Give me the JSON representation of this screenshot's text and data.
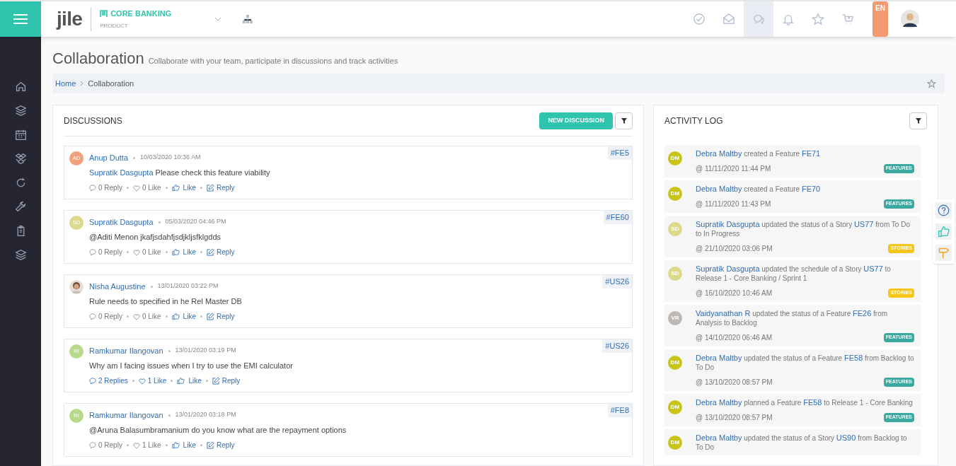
{
  "header": {
    "logo": "jile",
    "product_name": "CORE BANKING",
    "product_label": "PRODUCT",
    "language": "EN",
    "top_icons": [
      {
        "kind": "check",
        "selected": false
      },
      {
        "kind": "mail",
        "selected": false
      },
      {
        "kind": "chat",
        "selected": true
      },
      {
        "kind": "bell",
        "selected": false
      },
      {
        "kind": "star",
        "selected": false
      },
      {
        "kind": "cart",
        "selected": false
      }
    ]
  },
  "sidebar": {
    "items": [
      {
        "kind": "home"
      },
      {
        "kind": "layers"
      },
      {
        "kind": "calendar"
      },
      {
        "kind": "box"
      },
      {
        "kind": "cycle"
      },
      {
        "kind": "wrench"
      },
      {
        "kind": "clipboard"
      },
      {
        "kind": "layers"
      }
    ]
  },
  "page": {
    "title": "Collaboration",
    "subtitle": "Collaborate with your team, participate in discussions and track activities"
  },
  "breadcrumb": [
    "Home",
    "Collaboration"
  ],
  "discussions": {
    "title": "DISCUSSIONS",
    "new_button": "NEW DISCUSSION",
    "items": [
      {
        "avatar": {
          "kind": "initials",
          "initials": "AD",
          "color": "#f0a07a"
        },
        "author": "Anup Dutta",
        "time": "10/03/2020 10:36 AM",
        "tag": "#FE5",
        "mention": "Supratik Dasgupta",
        "body": "Please check this feature viability",
        "replies": "0 Reply",
        "likes": "0 Like",
        "like": "Like",
        "reply": "Reply",
        "highlighted": false
      },
      {
        "avatar": {
          "kind": "initials",
          "initials": "SD",
          "color": "#dcd98a"
        },
        "author": "Supratik Dasgupta",
        "time": "05/03/2020 04:46 PM",
        "tag": "#FE60",
        "body": "@Aditi Menon jkafjsdahfjsdjkljsfklgdds",
        "replies": "0 Reply",
        "likes": "0 Like",
        "like": "Like",
        "reply": "Reply",
        "highlighted": false
      },
      {
        "author": "Nisha Augustine",
        "time": "13/01/2020 03:22 PM",
        "tag": "#US26",
        "body": "Rule needs to specified in he Rel Master DB",
        "replies": "0 Reply",
        "likes": "0 Like",
        "like": "Like",
        "reply": "Reply",
        "highlighted": false
      },
      {
        "avatar": {
          "kind": "initials",
          "initials": "RI",
          "color": "#b9d98a"
        },
        "author": "Ramkumar Ilangovan",
        "time": "13/01/2020 03:19 PM",
        "tag": "#US26",
        "body": "Why am I facing issues when I try to use the EMI calculator",
        "replies": "2 Replies",
        "likes": "1 Like",
        "like": "Like",
        "reply": "Reply",
        "highlighted": true
      },
      {
        "avatar": {
          "kind": "initials",
          "initials": "RI",
          "color": "#b9d98a"
        },
        "author": "Ramkumar Ilangovan",
        "time": "13/01/2020 03:18 PM",
        "tag": "#FE8",
        "body": "@Aruna Balasumbramanium do you know what are the repayment options",
        "replies": "0 Reply",
        "likes": "1 Like",
        "like": "Like",
        "reply": "Reply",
        "highlighted": false
      }
    ]
  },
  "activity_log": {
    "title": "ACTIVITY LOG",
    "items": [
      {
        "avatar": {
          "initials": "DM",
          "color": "#c8c41a"
        },
        "actor": "Debra Maltby",
        "action": "created a Feature",
        "item": "FE71",
        "time": "@ 11/11/2020 11:44 PM",
        "tag": {
          "label": "FEATURES",
          "color": "#3aa99f"
        }
      },
      {
        "avatar": {
          "initials": "DM",
          "color": "#c8c41a"
        },
        "actor": "Debra Maltby",
        "action": "created a Feature",
        "item": "FE70",
        "time": "@ 11/11/2020 11:43 PM",
        "tag": {
          "label": "FEATURES",
          "color": "#3aa99f"
        }
      },
      {
        "avatar": {
          "initials": "SD",
          "color": "#dcd98a"
        },
        "actor": "Supratik Dasgupta",
        "action": "updated the status of a Story",
        "item": "US77",
        "rest": "from To Do to In Progress",
        "time": "@ 21/10/2020 03:06 PM",
        "tag": {
          "label": "STORIES",
          "color": "#f5c518"
        }
      },
      {
        "avatar": {
          "initials": "SD",
          "color": "#dcd98a"
        },
        "actor": "Supratik Dasgupta",
        "action": "updated the schedule of a Story",
        "item": "US77",
        "rest": "to Release 1 - Core Banking / Sprint 1",
        "time": "@ 16/10/2020 10:46 AM",
        "tag": {
          "label": "STORIES",
          "color": "#f5c518"
        }
      },
      {
        "avatar": {
          "initials": "VR",
          "color": "#bdb8b2"
        },
        "actor": "Vaidyanathan R",
        "action": "updated the status of a Feature",
        "item": "FE26",
        "rest": "from Analysis to Backlog",
        "time": "@ 14/10/2020 06:46 AM",
        "tag": {
          "label": "FEATURES",
          "color": "#3aa99f"
        }
      },
      {
        "avatar": {
          "initials": "DM",
          "color": "#c8c41a"
        },
        "actor": "Debra Maltby",
        "action": "updated the status of a Feature",
        "item": "FE58",
        "rest": "from Backlog to To Do",
        "time": "@ 13/10/2020 08:57 PM",
        "tag": {
          "label": "FEATURES",
          "color": "#3aa99f"
        }
      },
      {
        "avatar": {
          "initials": "DM",
          "color": "#c8c41a"
        },
        "actor": "Debra Maltby",
        "action": "planned a Feature",
        "item": "FE58",
        "rest": "to Release 1 - Core Banking",
        "time": "@ 13/10/2020 08:57 PM",
        "tag": {
          "label": "FEATURES",
          "color": "#3aa99f"
        }
      },
      {
        "avatar": {
          "initials": "DM",
          "color": "#c8c41a"
        },
        "actor": "Debra Maltby",
        "action": "updated the status of a Story",
        "item": "US90",
        "rest": "from Backlog to To Do"
      }
    ]
  }
}
